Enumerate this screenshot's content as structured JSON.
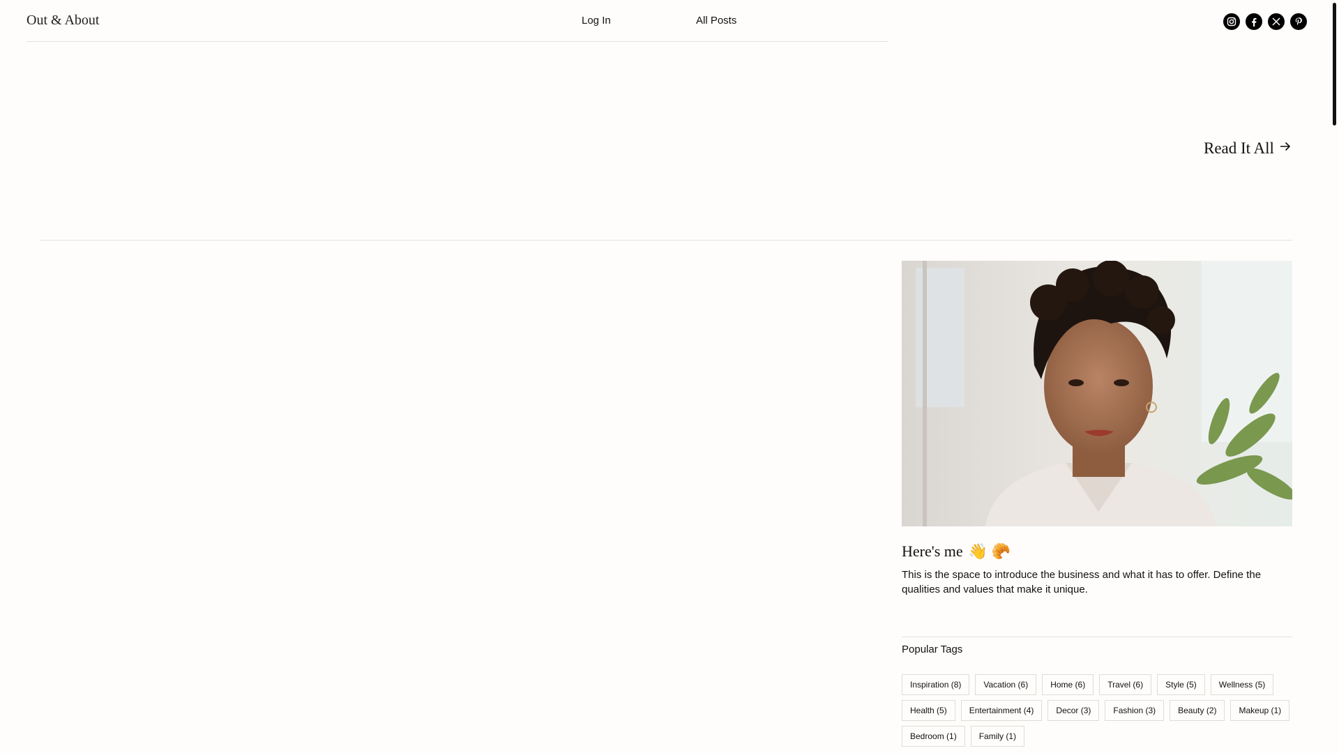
{
  "header": {
    "site_title": "Out & About",
    "nav": {
      "login": "Log In",
      "all_posts": "All Posts"
    },
    "socials": [
      "instagram-icon",
      "facebook-icon",
      "x-icon",
      "pinterest-icon"
    ]
  },
  "hero": {
    "read_all": "Read It All"
  },
  "about": {
    "title": "Here's me",
    "emojis": "👋 🥐",
    "text": "This is the space to introduce the business and what it has to offer. Define the qualities and values that make it unique."
  },
  "tags": {
    "heading": "Popular Tags",
    "items": [
      "Inspiration (8)",
      "Vacation (6)",
      "Home (6)",
      "Travel (6)",
      "Style (5)",
      "Wellness (5)",
      "Health (5)",
      "Entertainment (4)",
      "Decor (3)",
      "Fashion (3)",
      "Beauty (2)",
      "Makeup (1)",
      "Bedroom (1)",
      "Family (1)"
    ]
  },
  "colors": {
    "background": "#fffdfb",
    "text": "#111111",
    "rule": "#e4e2df",
    "tag_border": "#dedbd7"
  }
}
